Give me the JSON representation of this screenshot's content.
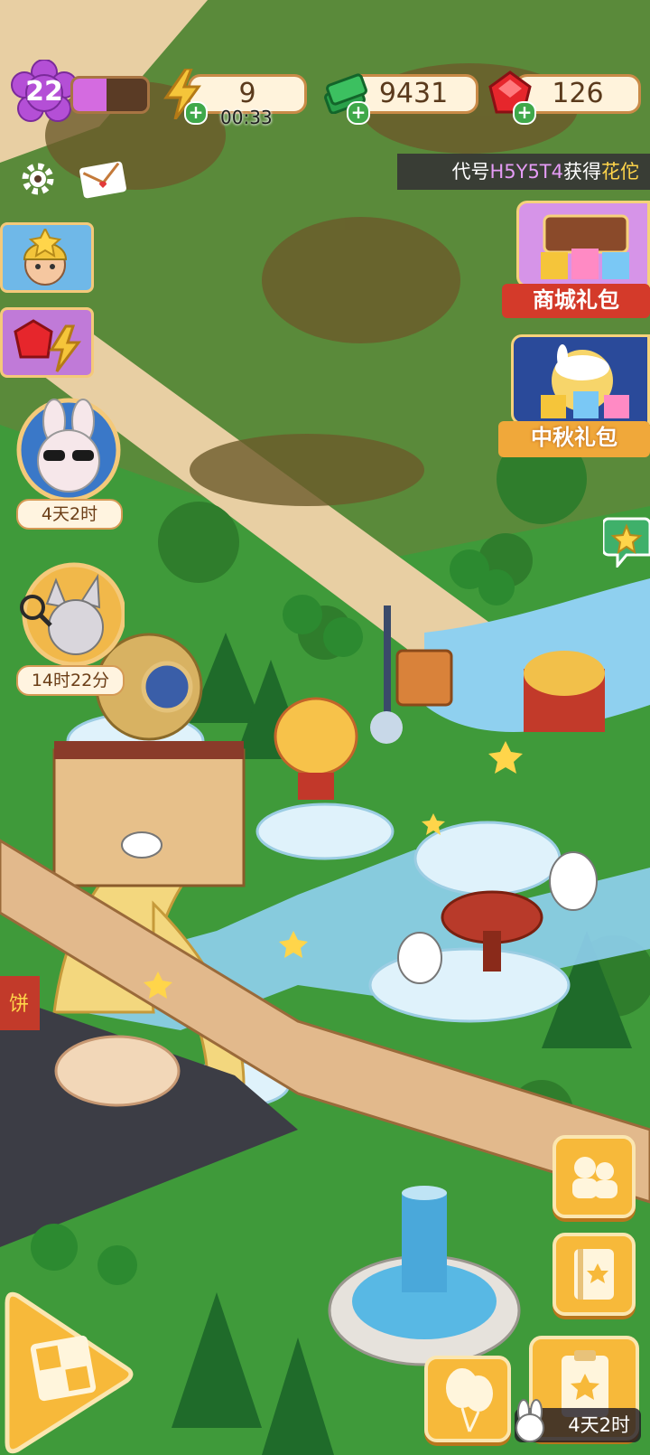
{
  "hud": {
    "level": "22",
    "xp_progress": 0.45,
    "energy": "9",
    "energy_timer": "00:33",
    "cash": "9431",
    "gems": "126"
  },
  "ticker": {
    "prefix": "代号",
    "code": "H5Y5T4",
    "verb": "获得",
    "item": "花佗"
  },
  "right_promos": {
    "shop_gift": "商城礼包",
    "mid_autumn_gift": "中秋礼包"
  },
  "left_events": {
    "bunny_timer": "4天2时",
    "detective_timer": "14时22分"
  },
  "bottom": {
    "event_timer": "4天2时"
  },
  "scene_sign": "饼",
  "colors": {
    "grass": "#3f9a3a",
    "path": "#e8cfa3",
    "water": "#8fd0ef",
    "accent_orange": "#f7b93a",
    "gift_red": "#d43a2a"
  }
}
